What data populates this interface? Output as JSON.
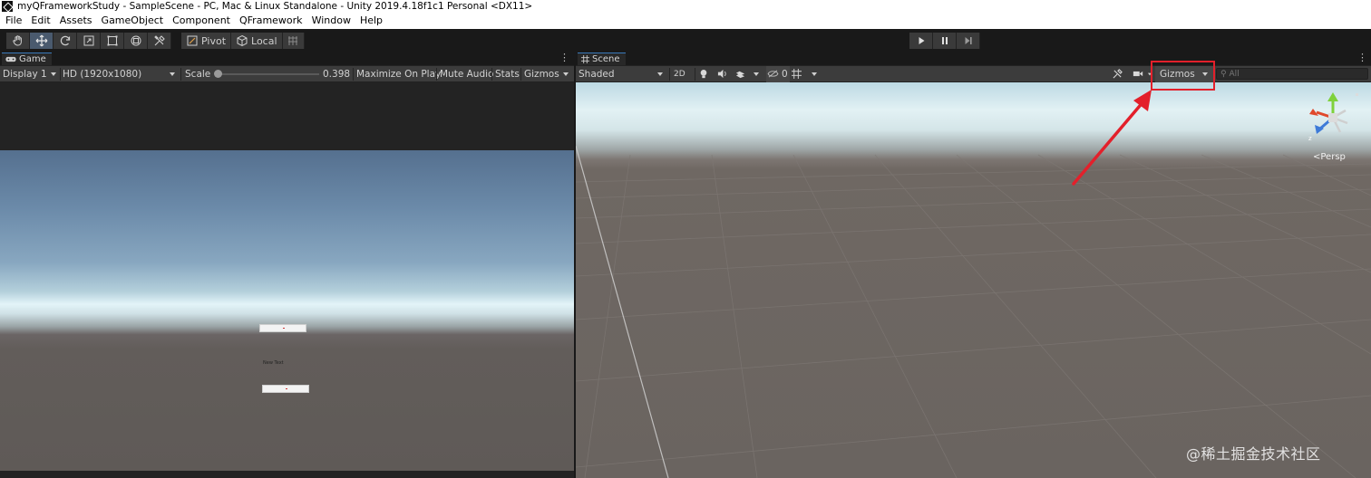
{
  "window": {
    "title": "myQFrameworkStudy - SampleScene - PC, Mac & Linux Standalone - Unity 2019.4.18f1c1 Personal <DX11>"
  },
  "menu": [
    "File",
    "Edit",
    "Assets",
    "GameObject",
    "Component",
    "QFramework",
    "Window",
    "Help"
  ],
  "toolbar": {
    "tools": [
      {
        "icon": "hand-icon",
        "active": false
      },
      {
        "icon": "move-icon",
        "active": true
      },
      {
        "icon": "rotate-icon",
        "active": false
      },
      {
        "icon": "scale-icon",
        "active": false
      },
      {
        "icon": "rect-icon",
        "active": false
      },
      {
        "icon": "transform-icon",
        "active": false
      },
      {
        "icon": "custom-tool-icon",
        "active": false
      }
    ],
    "pivot_label": "Pivot",
    "local_label": "Local",
    "play": [
      "play-icon",
      "pause-icon",
      "step-icon"
    ]
  },
  "game": {
    "tab_label": "Game",
    "display": "Display 1",
    "resolution": "HD (1920x1080)",
    "scale_label": "Scale",
    "scale_value": "0.398",
    "maximize_label": "Maximize On Play",
    "mute_label": "Mute Audio",
    "stats_label": "Stats",
    "gizmos_label": "Gizmos",
    "ui_text": "New Text"
  },
  "scene": {
    "tab_label": "Scene",
    "shading_mode": "Shaded",
    "mode_2d": "2D",
    "hidden_count": "0",
    "gizmos_label": "Gizmos",
    "search_placeholder": "All",
    "persp_label": "<Persp"
  },
  "watermark": "@稀土掘金技术社区",
  "colors": {
    "highlight": "#e3202b",
    "active_tool": "#4a5a6e",
    "tab_accent": "#3a79bb"
  }
}
